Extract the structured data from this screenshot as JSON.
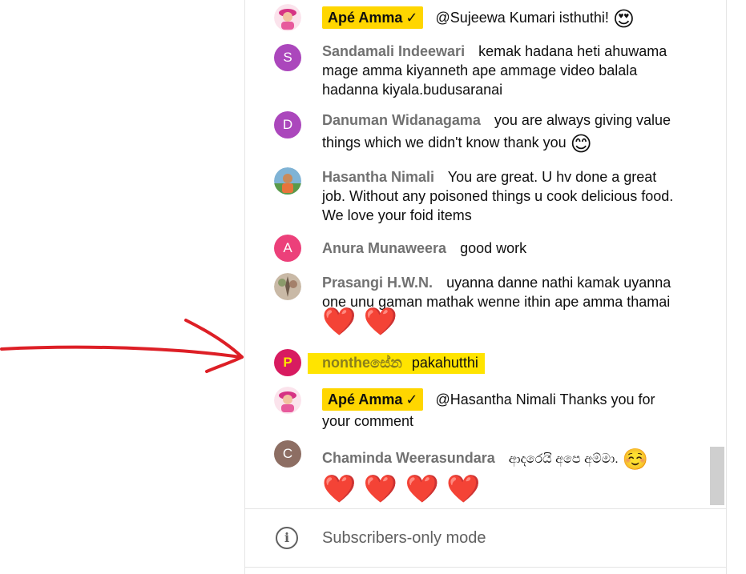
{
  "colors": {
    "owner_badge": "#ffd600",
    "highlight": "#ffe400",
    "arrow": "#dd1f26",
    "author": "#717171"
  },
  "messages": [
    {
      "author": "Apé Amma",
      "owner": true,
      "text": "@Sujeewa Kumari isthuthi!",
      "emoji": "😍"
    },
    {
      "author": "Sandamali Indeewari",
      "avatar_letter": "S",
      "avatar_color": "#ab47bc",
      "text": "kemak hadana heti ahuwama mage amma kiyanneth ape ammage video balala hadanna kiyala.budusaranai"
    },
    {
      "author": "Danuman Widanagama",
      "avatar_letter": "D",
      "avatar_color": "#ab47bc",
      "text": "you are always giving value things which we didn't know thank you",
      "emoji": "😊"
    },
    {
      "author": "Hasantha Nimali",
      "text": "You are great. U hv done a great job. Without any poisoned things u cook delicious food. We love your foid items"
    },
    {
      "author": "Anura Munaweera",
      "avatar_letter": "A",
      "avatar_color": "#ec407a",
      "text": "good work"
    },
    {
      "author": "Prasangi H.W.N.",
      "text": "uyanna danne nathi kamak uyanna one unu gaman mathak wenne ithin ape amma thamai",
      "hearts": "❤️ ❤️"
    },
    {
      "author": "nontheසේන",
      "avatar_letter": "P",
      "avatar_color": "#d81b60",
      "text": "pakahutthi",
      "highlighted": true
    },
    {
      "author": "Apé Amma",
      "owner": true,
      "text": "@Hasantha Nimali Thanks you for your comment"
    },
    {
      "author": "Chaminda Weerasundara",
      "avatar_letter": "C",
      "avatar_color": "#8d6e63",
      "text": "ආදරෙයි අපෙ අම්මා.",
      "emoji": "☺️",
      "hearts": "❤️ ❤️ ❤️ ❤️"
    }
  ],
  "owner_check": "✓",
  "footer": {
    "icon": "info-icon",
    "icon_glyph": "i",
    "label": "Subscribers-only mode"
  }
}
